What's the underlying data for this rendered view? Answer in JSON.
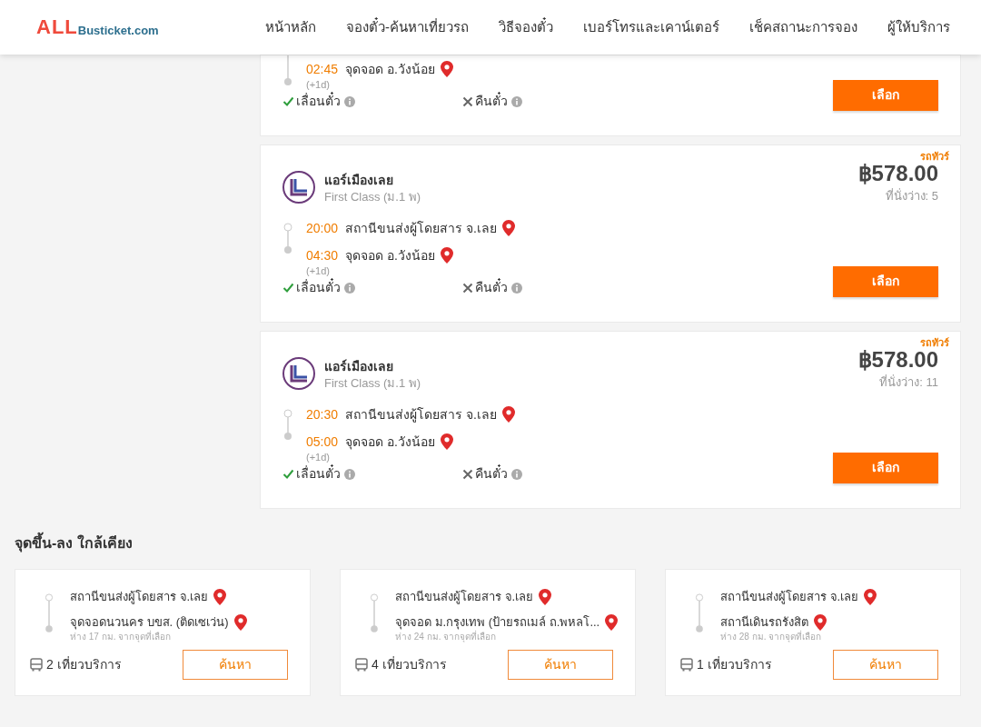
{
  "header": {
    "logo": {
      "brand": "ALL",
      "site": "Busticket.com"
    },
    "nav": [
      {
        "label": "หน้าหลัก"
      },
      {
        "label": "จองตั๋ว-ค้นหาเที่ยวรถ"
      },
      {
        "label": "วิธีจองตั๋ว"
      },
      {
        "label": "เบอร์โทรและเคาน์เตอร์"
      },
      {
        "label": "เช็คสถานะการจอง"
      },
      {
        "label": "ผู้ให้บริการ"
      }
    ]
  },
  "trips": [
    {
      "stops": [
        {
          "time": "02:45",
          "place": "จุดจอด อ.วังน้อย",
          "note": "(+1d)"
        }
      ],
      "policies": [
        {
          "label": "เลื่อนตั๋ว",
          "allowed": true
        },
        {
          "label": "คืนตั๋ว",
          "allowed": false
        }
      ],
      "button": "เลือก"
    },
    {
      "tag": "รถทัวร์",
      "operator": "แอร์เมืองเลย",
      "bus_class": "First Class (ม.1 พ)",
      "price": "฿578.00",
      "seats": "ที่นั่งว่าง: 5",
      "stops": [
        {
          "time": "20:00",
          "place": "สถานีขนส่งผู้โดยสาร จ.เลย"
        },
        {
          "time": "04:30",
          "place": "จุดจอด อ.วังน้อย",
          "note": "(+1d)"
        }
      ],
      "policies": [
        {
          "label": "เลื่อนตั๋ว",
          "allowed": true
        },
        {
          "label": "คืนตั๋ว",
          "allowed": false
        }
      ],
      "button": "เลือก"
    },
    {
      "tag": "รถทัวร์",
      "operator": "แอร์เมืองเลย",
      "bus_class": "First Class (ม.1 พ)",
      "price": "฿578.00",
      "seats": "ที่นั่งว่าง: 11",
      "stops": [
        {
          "time": "20:30",
          "place": "สถานีขนส่งผู้โดยสาร จ.เลย"
        },
        {
          "time": "05:00",
          "place": "จุดจอด อ.วังน้อย",
          "note": "(+1d)"
        }
      ],
      "policies": [
        {
          "label": "เลื่อนตั๋ว",
          "allowed": true
        },
        {
          "label": "คืนตั๋ว",
          "allowed": false
        }
      ],
      "button": "เลือก"
    }
  ],
  "nearby": {
    "title": "จุดขึ้น-ลง ใกล้เคียง",
    "cards": [
      {
        "from": "สถานีขนส่งผู้โดยสาร จ.เลย",
        "to": "จุดจอดนวนคร บขส. (ติดเซเว่น)",
        "distance": "ห่าง 17 กม. จากจุดที่เลือก",
        "trips": "2 เที่ยวบริการ",
        "button": "ค้นหา"
      },
      {
        "from": "สถานีขนส่งผู้โดยสาร จ.เลย",
        "to": "จุดจอด ม.กรุงเทพ (ป้ายรถเมล์ ถ.พหลโ...",
        "distance": "ห่าง 24 กม. จากจุดที่เลือก",
        "trips": "4 เที่ยวบริการ",
        "button": "ค้นหา"
      },
      {
        "from": "สถานีขนส่งผู้โดยสาร จ.เลย",
        "to": "สถานีเดินรถรังสิต",
        "distance": "ห่าง 28 กม. จากจุดที่เลือก",
        "trips": "1 เที่ยวบริการ",
        "button": "ค้นหา"
      }
    ]
  }
}
